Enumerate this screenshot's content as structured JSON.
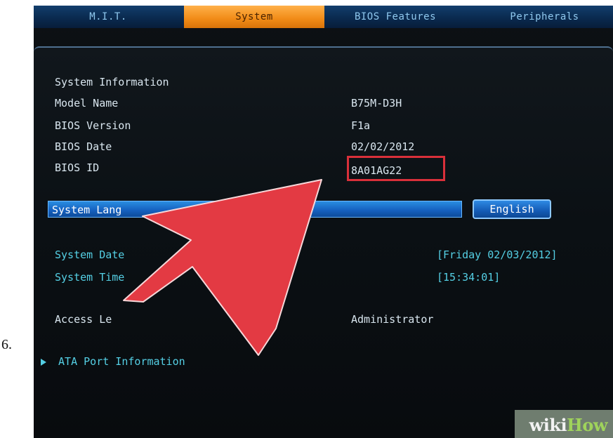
{
  "step": {
    "number": "6."
  },
  "tabs": [
    {
      "label": "M.I.T.",
      "active": false
    },
    {
      "label": "System",
      "active": true
    },
    {
      "label": "BIOS Features",
      "active": false
    },
    {
      "label": "Peripherals",
      "active": false
    }
  ],
  "system_info": {
    "section_title": "System Information",
    "model_name_label": "Model Name",
    "model_name_value": "B75M-D3H",
    "bios_version_label": "BIOS Version",
    "bios_version_value": "F1a",
    "bios_date_label": "BIOS Date",
    "bios_date_value": "02/02/2012",
    "bios_id_label": "BIOS ID",
    "bios_id_value": "8A01AG22"
  },
  "language": {
    "label": "System Lang",
    "value": "English"
  },
  "time": {
    "date_label": "System Date",
    "date_value": "[Friday 02/03/2012]",
    "time_label": "System Time",
    "time_value": "[15:34:01]"
  },
  "access": {
    "label": "Access Le",
    "value": "Administrator"
  },
  "submenu": {
    "label": "ATA Port Information"
  },
  "watermark": {
    "text": "wikiHow"
  },
  "colors": {
    "accent_orange": "#f18b16",
    "accent_blue": "#1662c1",
    "highlight_red": "#d9303a",
    "teal_text": "#54cfe4",
    "text_primary": "#d9e6ef",
    "arrow_red": "#e33a43"
  }
}
